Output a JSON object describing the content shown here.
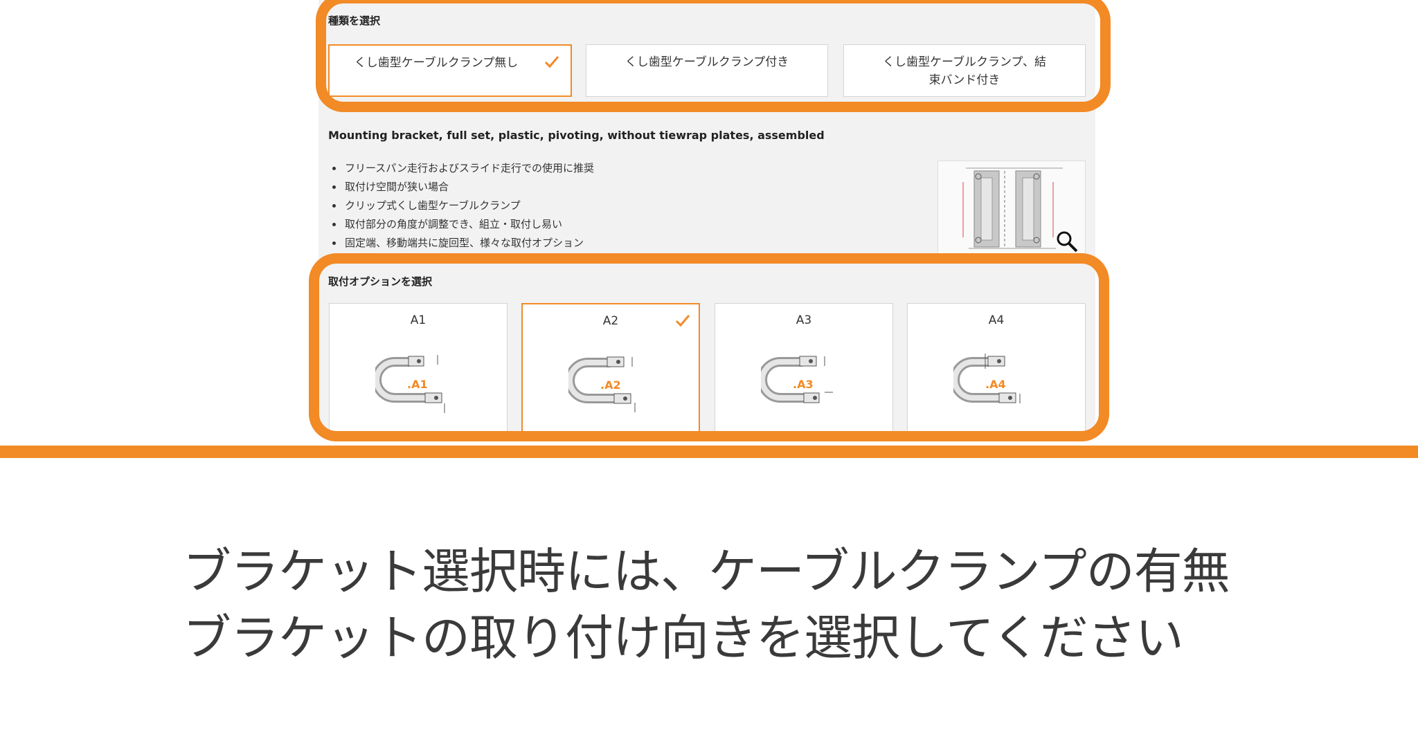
{
  "type_section": {
    "label": "種類を選択",
    "options": [
      {
        "label": "くし歯型ケーブルクランプ無し",
        "selected": true
      },
      {
        "label": "くし歯型ケーブルクランプ付き",
        "selected": false
      },
      {
        "label": "くし歯型ケーブルクランプ、結束バンド付き",
        "selected": false
      }
    ]
  },
  "product": {
    "title": "Mounting bracket, full set, plastic, pivoting, without tiewrap plates, assembled",
    "features": [
      "フリースパン走行およびスライド走行での使用に推奨",
      "取付け空間が狭い場合",
      "クリップ式くし歯型ケーブルクランプ",
      "取付部分の角度が調整でき、組立・取付し易い",
      "固定端、移動端共に旋回型、様々な取付オプション"
    ]
  },
  "mount_section": {
    "label": "取付オプションを選択",
    "options": [
      {
        "label": "A1",
        "tag": ".A1",
        "selected": false
      },
      {
        "label": "A2",
        "tag": ".A2",
        "selected": true
      },
      {
        "label": "A3",
        "tag": ".A3",
        "selected": false
      },
      {
        "label": "A4",
        "tag": ".A4",
        "selected": false
      }
    ]
  },
  "caption": {
    "line1": "ブラケット選択時には、ケーブルクランプの有無",
    "line2": "ブラケットの取り付け向きを選択してください"
  },
  "colors": {
    "accent": "#f28a26",
    "panel": "#f2f2f2",
    "caption": "#3a3a3a"
  },
  "icons": [
    "check-icon",
    "zoom-icon",
    "bracket-diagram-icon"
  ]
}
